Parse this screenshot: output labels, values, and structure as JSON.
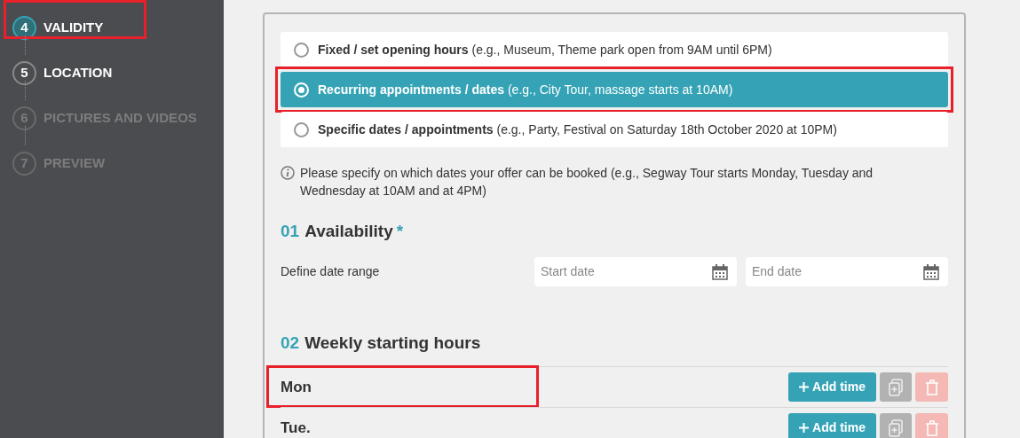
{
  "steps": [
    {
      "number": "4",
      "label": "VALIDITY",
      "current": true,
      "disabled": false,
      "highlighted": true
    },
    {
      "number": "5",
      "label": "LOCATION",
      "current": false,
      "disabled": false,
      "highlighted": false
    },
    {
      "number": "6",
      "label": "PICTURES AND VIDEOS",
      "current": false,
      "disabled": true,
      "highlighted": false
    },
    {
      "number": "7",
      "label": "PREVIEW",
      "current": false,
      "disabled": true,
      "highlighted": false
    }
  ],
  "validity_options": [
    {
      "label": "**Fixed / set opening hours** (e.g., Museum, Theme park open from 9AM until 6PM)",
      "selected": false,
      "highlighted": false
    },
    {
      "label": "**Recurring appointments / dates** (e.g., City Tour, massage starts at 10AM)",
      "selected": true,
      "highlighted": true
    },
    {
      "label": "**Specific dates / appointments** (e.g., Party, Festival on Saturday 18th October 2020 at 10PM)",
      "selected": false,
      "highlighted": false
    }
  ],
  "info_text": "Please specify on which dates your offer can be booked (e.g., Segway Tour starts Monday, Tuesday and Wednesday at 10AM and at 4PM)",
  "availability": {
    "number": "01",
    "title": "Availability",
    "required_mark": "*",
    "label": "Define date range",
    "start_placeholder": "Start date",
    "end_placeholder": "End date"
  },
  "weekly_hours": {
    "number": "02",
    "title": "Weekly starting hours",
    "days": [
      {
        "day": "Mon",
        "highlighted": true,
        "add_label": "Add time"
      },
      {
        "day": "Tue.",
        "highlighted": false,
        "add_label": "Add time"
      }
    ]
  }
}
